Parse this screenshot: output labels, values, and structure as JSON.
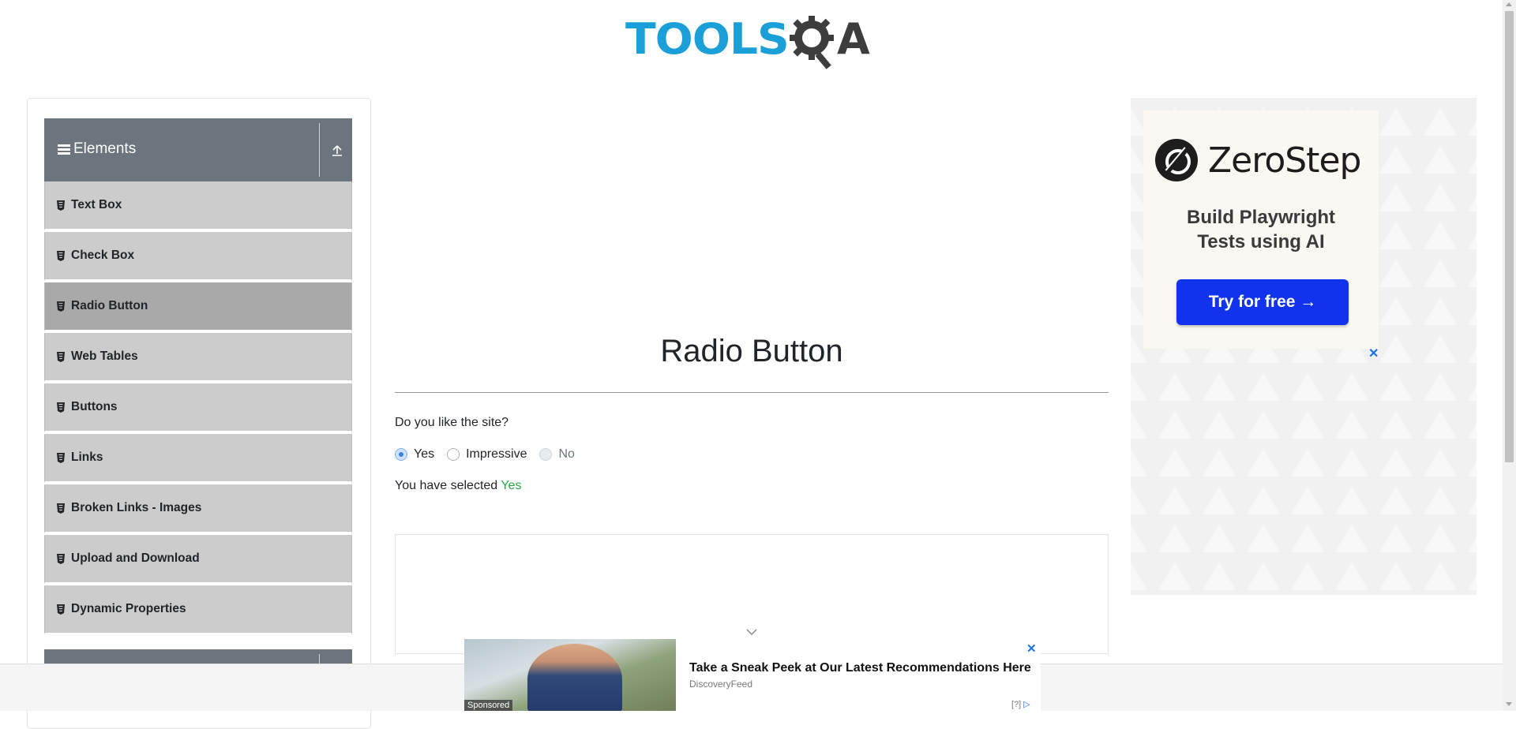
{
  "logo": {
    "text_primary": "TOOLS",
    "text_secondary": "A",
    "alt": "ToolsQA"
  },
  "sidebar": {
    "group_title": "Elements",
    "items": [
      {
        "label": "Text Box"
      },
      {
        "label": "Check Box"
      },
      {
        "label": "Radio Button",
        "active": true
      },
      {
        "label": "Web Tables"
      },
      {
        "label": "Buttons"
      },
      {
        "label": "Links"
      },
      {
        "label": "Broken Links - Images"
      },
      {
        "label": "Upload and Download"
      },
      {
        "label": "Dynamic Properties"
      }
    ]
  },
  "main": {
    "title": "Radio Button",
    "question": "Do you like the site?",
    "options": [
      {
        "label": "Yes",
        "checked": true,
        "disabled": false
      },
      {
        "label": "Impressive",
        "checked": false,
        "disabled": false
      },
      {
        "label": "No",
        "checked": false,
        "disabled": true
      }
    ],
    "result_prefix": "You have selected",
    "result_value": "Yes"
  },
  "ad_right": {
    "brand": "ZeroStep",
    "tagline_line1": "Build Playwright",
    "tagline_line2": "Tests using AI",
    "cta": "Try for free →",
    "close": "✕"
  },
  "bottom_ad": {
    "headline": "Take a Sneak Peek at Our Latest Recommendations Here",
    "source": "DiscoveryFeed",
    "sponsored": "Sponsored",
    "close": "✕",
    "adchoices": "[?]"
  },
  "colors": {
    "sidebar_header": "#6c757d",
    "menu_item": "#cccccc",
    "menu_item_active": "#a9a9a9",
    "success": "#28a745",
    "cta_blue": "#1133ee",
    "logo_blue": "#1a9fd9"
  }
}
